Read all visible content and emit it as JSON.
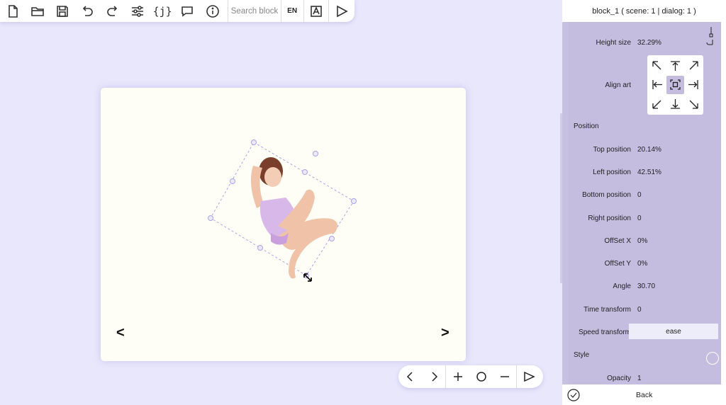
{
  "toolbar": {
    "icons": [
      "new-file-icon",
      "open-folder-icon",
      "save-icon",
      "undo-icon",
      "redo-icon",
      "settings-sliders-icon",
      "variables-icon",
      "comment-icon",
      "info-icon"
    ],
    "search_placeholder": "Search block",
    "language": "EN",
    "variables_label": "{j}"
  },
  "stage": {
    "prev_label": "<",
    "next_label": ">"
  },
  "panel": {
    "header": "block_1 ( scene: 1 | dialog: 1 )",
    "height_size_label": "Height size",
    "height_size_value": "32.29%",
    "align_art_label": "Align art",
    "position_section": "Position",
    "top_position_label": "Top position",
    "top_position_value": "20.14%",
    "left_position_label": "Left position",
    "left_position_value": "42.51%",
    "bottom_position_label": "Bottom position",
    "bottom_position_value": "0",
    "right_position_label": "Right position",
    "right_position_value": "0",
    "offset_x_label": "OffSet X",
    "offset_x_value": "0%",
    "offset_y_label": "OffSet Y",
    "offset_y_value": "0%",
    "angle_label": "Angle",
    "angle_value": "30.70",
    "time_transform_label": "Time transform",
    "time_transform_value": "0",
    "speed_transform_label": "Speed transform",
    "speed_transform_value": "ease",
    "style_section": "Style",
    "opacity_label": "Opacity",
    "opacity_value": "1",
    "back_label": "Back"
  },
  "colors": {
    "background": "#e9e7fb",
    "panel": "#c4bde0",
    "stage": "#fefef6",
    "selection": "#a9a3e6"
  }
}
